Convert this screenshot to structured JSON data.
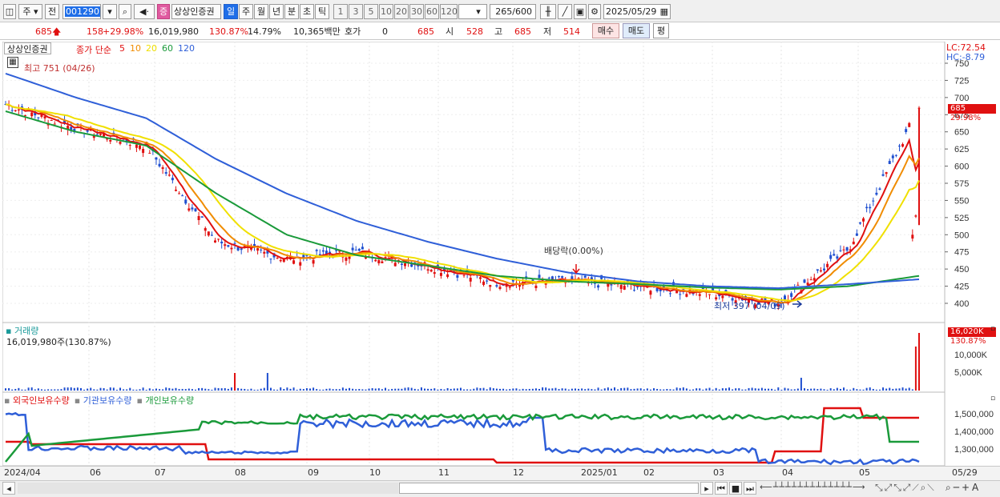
{
  "toolbar": {
    "market": "주",
    "period_prev": "전",
    "stock_code": "001290",
    "stock_name": "상상인증권",
    "stock_badge": "증",
    "periods": [
      "일",
      "주",
      "월",
      "년",
      "분",
      "초",
      "틱"
    ],
    "selected_period": "일",
    "intervals": [
      "1",
      "3",
      "5",
      "10",
      "20",
      "30",
      "60",
      "120"
    ],
    "count": "265",
    "count_total": "/600",
    "date": "2025/05/29"
  },
  "info": {
    "price": "685",
    "change": "158",
    "change_pct": "+29.98%",
    "volume": "16,019,980",
    "volume_ratio": "130.87%",
    "turnover": "14.79%",
    "amount": "10,365백만",
    "quote_label": "호가",
    "quote_value": "0",
    "ask": "685",
    "open_label": "시",
    "open": "528",
    "high_label": "고",
    "high": "685",
    "low_label": "저",
    "low": "514",
    "buy_label": "매수",
    "sell_label": "매도",
    "eval_label": "평"
  },
  "price_panel": {
    "legend_name": "상상인증권",
    "legend_ma_label": "종가 단순",
    "ma_periods": [
      "5",
      "10",
      "20",
      "60",
      "120"
    ],
    "ma_colors": [
      "#e01010",
      "#f08c00",
      "#f0e000",
      "#1a9a3a",
      "#2f5fd8"
    ],
    "high_marker": "최고 751 (04/26)",
    "low_marker": "최저 397 (04/09)",
    "dividend_marker": "배당락(0.00%)",
    "lc_label": "LC:72.54",
    "hc_label": "HC:-8.79",
    "current_price_tag": "685",
    "current_pct_tag": "29.98%",
    "y_ticks": [
      "750",
      "725",
      "700",
      "675",
      "650",
      "625",
      "600",
      "575",
      "550",
      "525",
      "500",
      "475",
      "450",
      "425",
      "400"
    ]
  },
  "volume_panel": {
    "title": "거래량",
    "summary": "16,019,980주(130.87%)",
    "current_tag": "16,020K",
    "current_pct": "130.87%",
    "y_ticks": [
      "10,000K",
      "5,000K"
    ]
  },
  "holding_panel": {
    "series_labels": [
      "외국인보유수량",
      "기관보유수량",
      "개인보유수량"
    ],
    "series_colors": [
      "#e01010",
      "#2f5fd8",
      "#1a9a3a"
    ],
    "y_ticks": [
      "1,500,000",
      "1,400,000",
      "1,300,000"
    ]
  },
  "x_axis": {
    "labels": [
      "2024/04",
      "06",
      "07",
      "08",
      "09",
      "10",
      "11",
      "12",
      "2025/01",
      "02",
      "03",
      "04",
      "05"
    ],
    "last_date": "05/29"
  },
  "chart_data": {
    "type": "line",
    "title": "상상인증권",
    "x": [
      "2024/04",
      "06",
      "07",
      "08",
      "09",
      "10",
      "11",
      "12",
      "2025/01",
      "02",
      "03",
      "04",
      "05",
      "05/29"
    ],
    "series": [
      {
        "name": "종가",
        "values": [
          690,
          655,
          630,
          490,
          465,
          475,
          455,
          430,
          432,
          425,
          415,
          400,
          480,
          685
        ]
      },
      {
        "name": "120",
        "values": [
          735,
          700,
          670,
          610,
          560,
          520,
          490,
          465,
          445,
          432,
          425,
          422,
          428,
          435
        ]
      },
      {
        "name": "60",
        "values": [
          680,
          650,
          630,
          560,
          500,
          470,
          455,
          440,
          432,
          428,
          423,
          420,
          425,
          440
        ]
      }
    ],
    "ylim": [
      390,
      760
    ],
    "high": {
      "value": 751,
      "date": "04/26"
    },
    "low": {
      "value": 397,
      "date": "04/09"
    }
  }
}
